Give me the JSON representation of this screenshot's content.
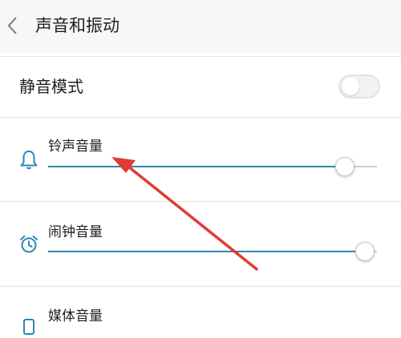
{
  "header": {
    "title": "声音和振动",
    "back_icon": "back-chevron-icon"
  },
  "silent_mode": {
    "label": "静音模式",
    "enabled": false
  },
  "volumes": [
    {
      "label": "铃声音量",
      "icon": "bell-icon",
      "level": 0.9
    },
    {
      "label": "闹钟音量",
      "icon": "alarm-clock-icon",
      "level": 0.96
    },
    {
      "label": "媒体音量",
      "icon": "media-icon"
    }
  ],
  "colors": {
    "accent": "#2f86b3",
    "annotation_arrow": "#e03a33"
  }
}
